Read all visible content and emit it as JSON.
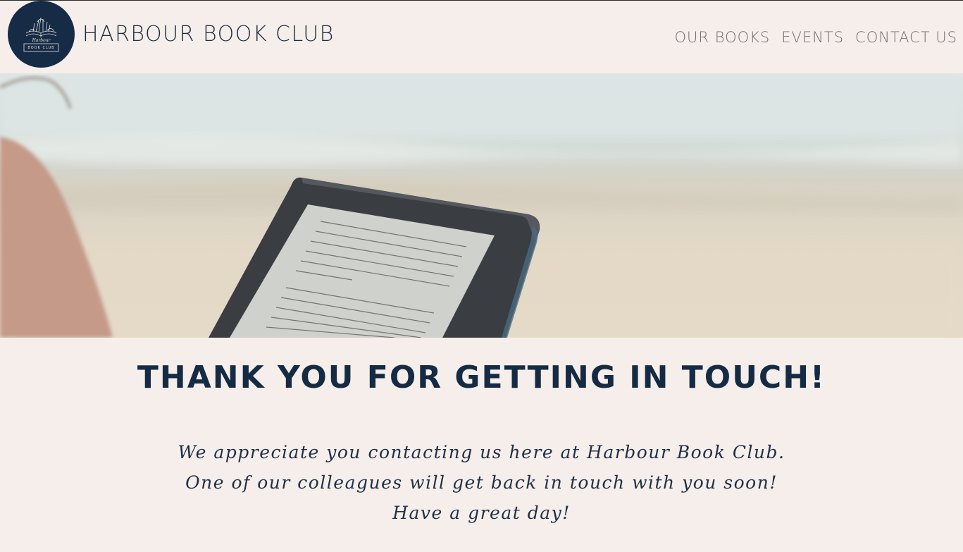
{
  "header": {
    "logo": {
      "icon": "open-book-icon",
      "script_text": "Harbour",
      "tag_text": "BOOK CLUB"
    },
    "title": "HARBOUR BOOK CLUB",
    "nav": [
      {
        "label": "OUR BOOKS"
      },
      {
        "label": "EVENTS"
      },
      {
        "label": "CONTACT US"
      }
    ]
  },
  "hero": {
    "image_description_icon": "ereader-beach-photo"
  },
  "main": {
    "heading": "THANK YOU FOR GETTING IN TOUCH!",
    "lines": [
      "We appreciate you contacting us here at Harbour Book Club.",
      "One of our colleagues will get back in touch with you soon!",
      "Have a great day!"
    ]
  },
  "colors": {
    "background": "#f6eeeb",
    "brand_navy": "#162b45",
    "nav_text": "#6f6f6f"
  }
}
